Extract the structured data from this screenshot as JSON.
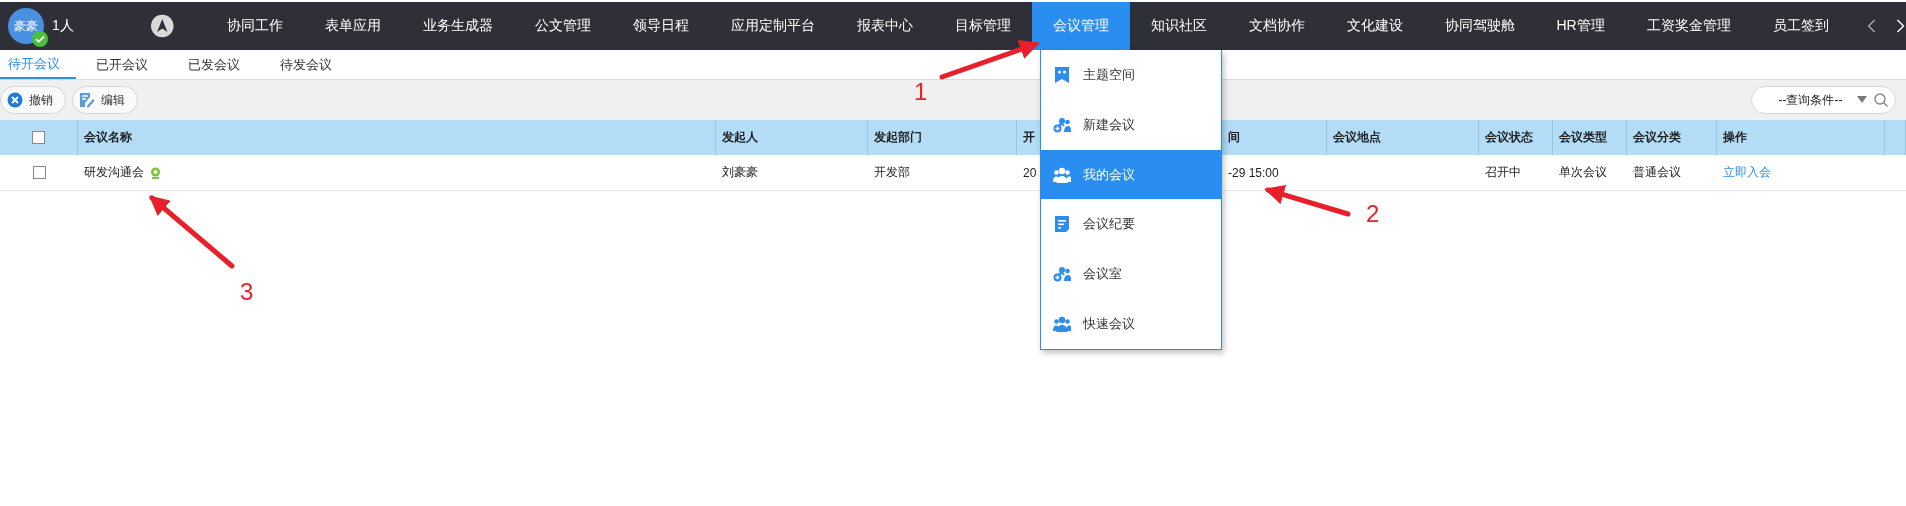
{
  "top_bar": {
    "avatar": {
      "text": "豪豪"
    },
    "online_count": "1人",
    "nav_items": [
      {
        "label": "协同工作",
        "selected": false
      },
      {
        "label": "表单应用",
        "selected": false
      },
      {
        "label": "业务生成器",
        "selected": false
      },
      {
        "label": "公文管理",
        "selected": false
      },
      {
        "label": "领导日程",
        "selected": false
      },
      {
        "label": "应用定制平台",
        "selected": false
      },
      {
        "label": "报表中心",
        "selected": false
      },
      {
        "label": "目标管理",
        "selected": false
      },
      {
        "label": "会议管理",
        "selected": true
      },
      {
        "label": "知识社区",
        "selected": false
      },
      {
        "label": "文档协作",
        "selected": false
      },
      {
        "label": "文化建设",
        "selected": false
      },
      {
        "label": "协同驾驶舱",
        "selected": false
      },
      {
        "label": "HR管理",
        "selected": false
      },
      {
        "label": "工资奖金管理",
        "selected": false
      },
      {
        "label": "员工签到",
        "selected": false
      }
    ]
  },
  "sub_tabs": [
    {
      "label": "待开会议",
      "selected": true
    },
    {
      "label": "已开会议",
      "selected": false
    },
    {
      "label": "已发会议",
      "selected": false
    },
    {
      "label": "待发会议",
      "selected": false
    }
  ],
  "toolbar": {
    "buttons": [
      {
        "label": "撤销",
        "kind": "cancel"
      },
      {
        "label": "编辑",
        "kind": "edit"
      }
    ],
    "query_select": {
      "value": "--查询条件--"
    }
  },
  "table": {
    "header_checkbox": {
      "checked": false
    },
    "columns": [
      "会议名称",
      "发起人",
      "发起部门",
      "开",
      "间",
      "会议地点",
      "会议状态",
      "会议类型",
      "会议分类",
      "操作"
    ],
    "rows": [
      {
        "checked": false,
        "name": "研发沟通会",
        "initiator": "刘豪豪",
        "department": "开发部",
        "column_4": "20",
        "column_5": "-29 15:00",
        "status": "召开中",
        "type": "单次会议",
        "category": "普通会议",
        "action": "立即入会"
      }
    ]
  },
  "dropdown": {
    "items": [
      {
        "label": "主题空间",
        "selected": false
      },
      {
        "label": "新建会议",
        "selected": false
      },
      {
        "label": "我的会议",
        "selected": true
      },
      {
        "label": "会议纪要",
        "selected": false
      },
      {
        "label": "会议室",
        "selected": false
      },
      {
        "label": "快速会议",
        "selected": false
      }
    ]
  },
  "annotations": [
    {
      "label": "1"
    },
    {
      "label": "2"
    },
    {
      "label": "3"
    }
  ]
}
